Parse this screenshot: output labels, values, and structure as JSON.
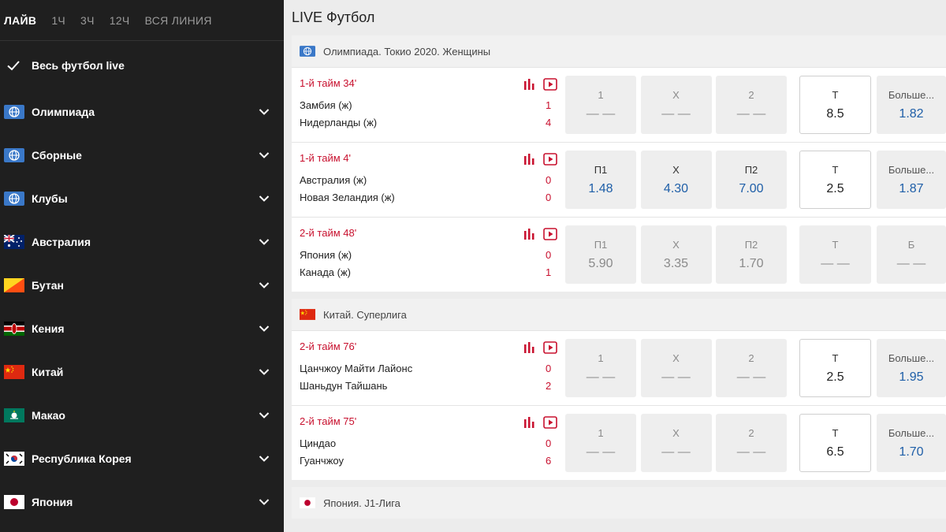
{
  "sidebar": {
    "tabs": [
      {
        "label": "ЛАЙВ",
        "active": true
      },
      {
        "label": "1Ч",
        "active": false
      },
      {
        "label": "3Ч",
        "active": false
      },
      {
        "label": "12Ч",
        "active": false
      },
      {
        "label": "ВСЯ ЛИНИЯ",
        "active": false
      }
    ],
    "all_live_label": "Весь футбол live",
    "items": [
      {
        "label": "Олимпиада",
        "flag": "globe-icon"
      },
      {
        "label": "Сборные",
        "flag": "globe-icon"
      },
      {
        "label": "Клубы",
        "flag": "globe-icon"
      },
      {
        "label": "Австралия",
        "flag": "australia-flag-icon"
      },
      {
        "label": "Бутан",
        "flag": "bhutan-flag-icon"
      },
      {
        "label": "Кения",
        "flag": "kenya-flag-icon"
      },
      {
        "label": "Китай",
        "flag": "china-flag-icon"
      },
      {
        "label": "Макао",
        "flag": "macau-flag-icon"
      },
      {
        "label": "Республика Корея",
        "flag": "south-korea-flag-icon"
      },
      {
        "label": "Япония",
        "flag": "japan-flag-icon"
      }
    ]
  },
  "main": {
    "title": "LIVE Футбол",
    "leagues": [
      {
        "name": "Олимпиада. Токио 2020. Женщины",
        "flag": "globe-icon",
        "matches": [
          {
            "time": "1-й тайм 34'",
            "team1": "Замбия (ж)",
            "team2": "Нидерланды (ж)",
            "score1": "1",
            "score2": "4",
            "odds": [
              {
                "label": "1",
                "value": "— —"
              },
              {
                "label": "Х",
                "value": "— —"
              },
              {
                "label": "2",
                "value": "— —"
              }
            ],
            "total": {
              "label": "Т",
              "value": "8.5"
            },
            "more": {
              "label": "Больше...",
              "value": "1.82"
            }
          },
          {
            "time": "1-й тайм 4'",
            "team1": "Австралия (ж)",
            "team2": "Новая Зеландия (ж)",
            "score1": "0",
            "score2": "0",
            "odds": [
              {
                "label": "П1",
                "value": "1.48"
              },
              {
                "label": "Х",
                "value": "4.30"
              },
              {
                "label": "П2",
                "value": "7.00"
              }
            ],
            "total": {
              "label": "Т",
              "value": "2.5"
            },
            "more": {
              "label": "Больше...",
              "value": "1.87"
            }
          },
          {
            "time": "2-й тайм 48'",
            "team1": "Япония (ж)",
            "team2": "Канада (ж)",
            "score1": "0",
            "score2": "1",
            "odds": [
              {
                "label": "П1",
                "value": "5.90"
              },
              {
                "label": "Х",
                "value": "3.35"
              },
              {
                "label": "П2",
                "value": "1.70"
              }
            ],
            "total": {
              "label": "Т",
              "value": "— —"
            },
            "more": {
              "label": "Б",
              "value": "— —"
            }
          }
        ]
      },
      {
        "name": "Китай. Суперлига",
        "flag": "china-flag-icon",
        "matches": [
          {
            "time": "2-й тайм 76'",
            "team1": "Цанчжоу Майти Лайонс",
            "team2": "Шаньдун Тайшань",
            "score1": "0",
            "score2": "2",
            "odds": [
              {
                "label": "1",
                "value": "— —"
              },
              {
                "label": "Х",
                "value": "— —"
              },
              {
                "label": "2",
                "value": "— —"
              }
            ],
            "total": {
              "label": "Т",
              "value": "2.5"
            },
            "more": {
              "label": "Больше...",
              "value": "1.95"
            }
          },
          {
            "time": "2-й тайм 75'",
            "team1": "Циндао",
            "team2": "Гуанчжоу",
            "score1": "0",
            "score2": "6",
            "odds": [
              {
                "label": "1",
                "value": "— —"
              },
              {
                "label": "Х",
                "value": "— —"
              },
              {
                "label": "2",
                "value": "— —"
              }
            ],
            "total": {
              "label": "Т",
              "value": "6.5"
            },
            "more": {
              "label": "Больше...",
              "value": "1.70"
            }
          }
        ]
      },
      {
        "name": "Япония. J1-Лига",
        "flag": "japan-flag-icon",
        "matches": []
      }
    ]
  },
  "colors": {
    "accent_red": "#c8102e",
    "odds_blue": "#1f5fa8",
    "sidebar_bg": "#1f1f1f"
  }
}
